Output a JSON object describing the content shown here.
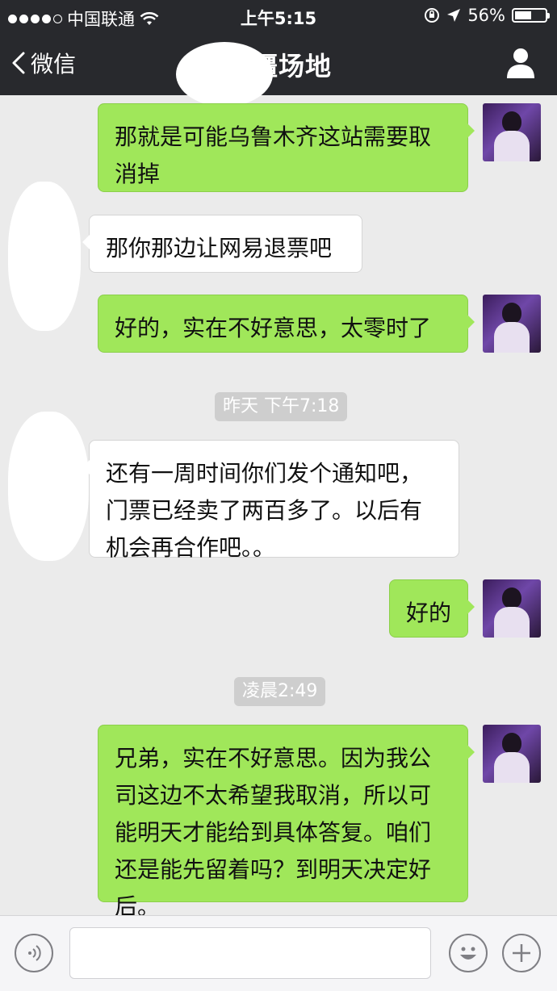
{
  "status": {
    "carrier": "中国联通",
    "time": "上午5:15",
    "battery_text": "56%",
    "battery_level": 0.56
  },
  "nav": {
    "back_label": "微信",
    "title": "新疆场地"
  },
  "messages": [
    {
      "type": "out",
      "text": "那就是可能乌鲁木齐这站需要取消掉"
    },
    {
      "type": "in",
      "text": "那你那边让网易退票吧"
    },
    {
      "type": "out",
      "text": "好的，实在不好意思，太零时了"
    },
    {
      "type": "time",
      "text": "昨天 下午7:18"
    },
    {
      "type": "in",
      "text": "还有一周时间你们发个通知吧，门票已经卖了两百多了。以后有机会再合作吧。。"
    },
    {
      "type": "out",
      "text": "好的"
    },
    {
      "type": "time",
      "text": "凌晨2:49"
    },
    {
      "type": "out",
      "text": "兄弟，实在不好意思。因为我公司这边不太希望我取消，所以可能明天才能给到具体答复。咱们还是能先留着吗？到明天决定好后。"
    }
  ],
  "input": {
    "value": "",
    "placeholder": ""
  },
  "colors": {
    "bar_bg": "#28292d",
    "chat_bg": "#ebebeb",
    "out_bubble": "#a0e75a",
    "in_bubble": "#ffffff"
  }
}
